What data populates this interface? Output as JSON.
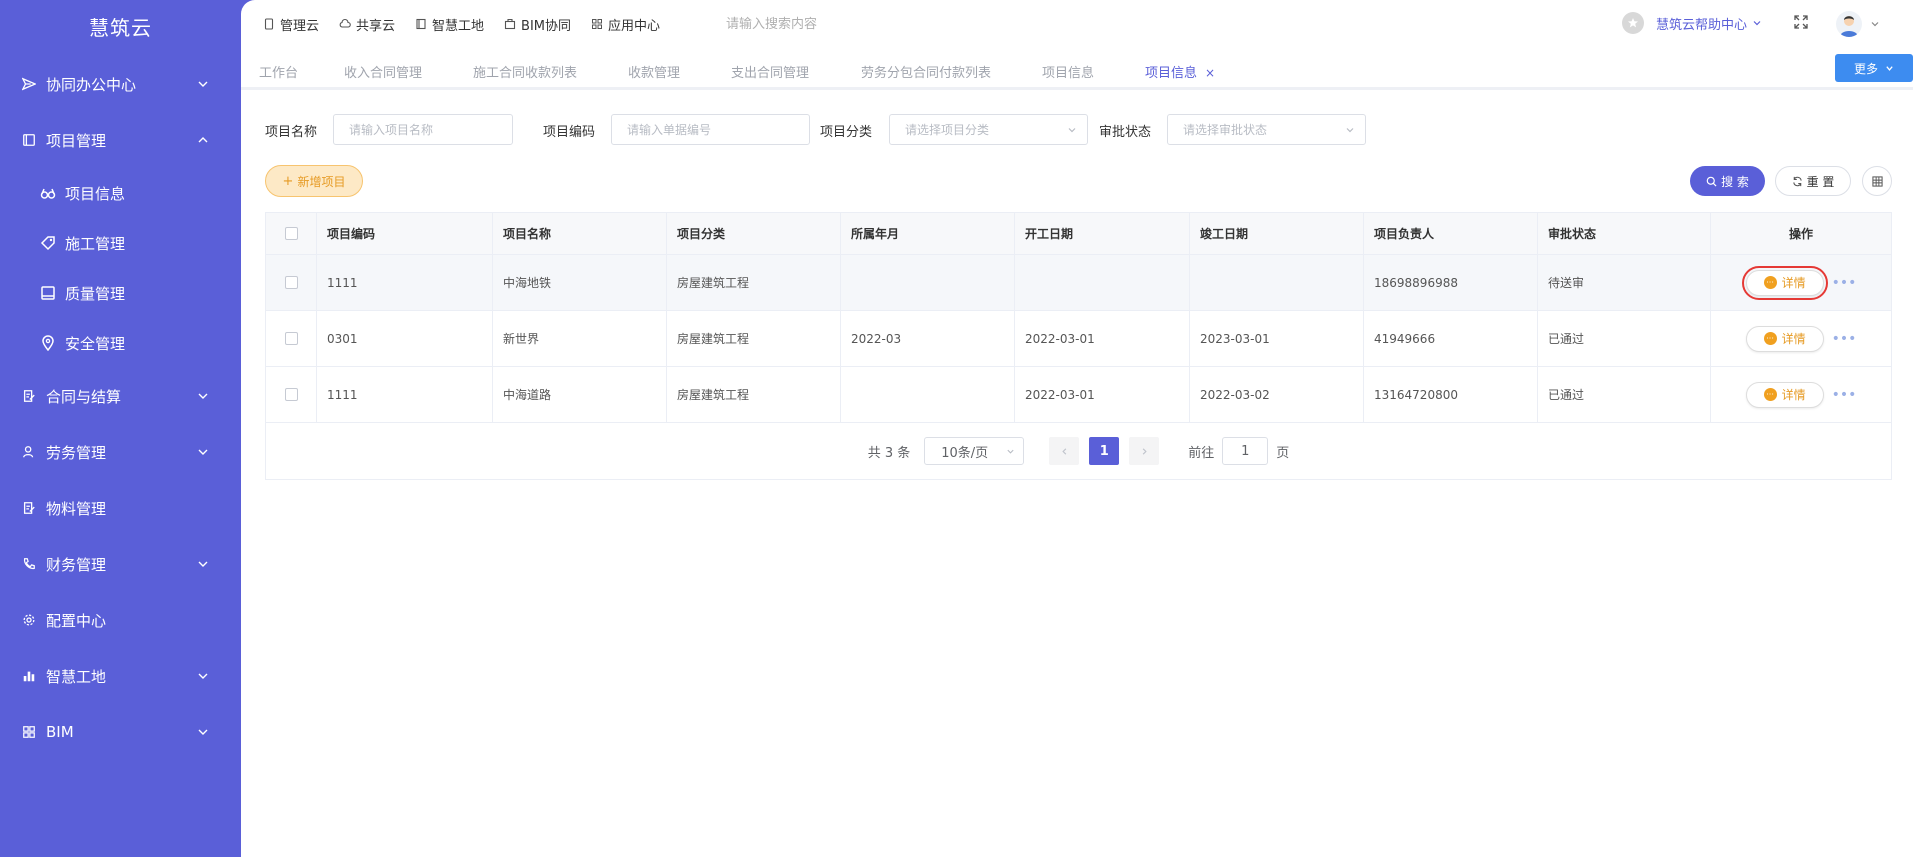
{
  "sidebar": {
    "brand": "慧筑云",
    "items": [
      {
        "label": "协同办公中心"
      },
      {
        "label": "项目管理"
      },
      {
        "label": "项目信息"
      },
      {
        "label": "施工管理"
      },
      {
        "label": "质量管理"
      },
      {
        "label": "安全管理"
      },
      {
        "label": "合同与结算"
      },
      {
        "label": "劳务管理"
      },
      {
        "label": "物料管理"
      },
      {
        "label": "财务管理"
      },
      {
        "label": "配置中心"
      },
      {
        "label": "智慧工地"
      },
      {
        "label": "BIM"
      }
    ]
  },
  "topnav": {
    "items": [
      {
        "label": "管理云",
        "icon": "phone-icon"
      },
      {
        "label": "共享云",
        "icon": "cloud-icon"
      },
      {
        "label": "智慧工地",
        "icon": "book-icon"
      },
      {
        "label": "BIM协同",
        "icon": "box-icon"
      },
      {
        "label": "应用中心",
        "icon": "grid-icon"
      }
    ],
    "search_placeholder": "请输入搜索内容",
    "help_label": "慧筑云帮助中心"
  },
  "tabs": {
    "items": [
      {
        "label": "工作台"
      },
      {
        "label": "收入合同管理"
      },
      {
        "label": "施工合同收款列表"
      },
      {
        "label": "收款管理"
      },
      {
        "label": "支出合同管理"
      },
      {
        "label": "劳务分包合同付款列表"
      },
      {
        "label": "项目信息"
      },
      {
        "label": "项目信息",
        "active": true
      }
    ],
    "close": "×",
    "more_label": "更多"
  },
  "filters": {
    "name_label": "项目名称",
    "name_placeholder": "请输入项目名称",
    "code_label": "项目编码",
    "code_placeholder": "请输入单据编号",
    "category_label": "项目分类",
    "category_placeholder": "请选择项目分类",
    "status_label": "审批状态",
    "status_placeholder": "请选择审批状态"
  },
  "toolbar": {
    "add_label": "新增项目",
    "search_label": "搜 索",
    "reset_label": "重 置"
  },
  "table": {
    "headers": [
      "项目编码",
      "项目名称",
      "项目分类",
      "所属年月",
      "开工日期",
      "竣工日期",
      "项目负责人",
      "审批状态",
      "操作"
    ],
    "rows": [
      [
        "1111",
        "中海地铁",
        "房屋建筑工程",
        "",
        "",
        "",
        "18698896988",
        "待送审"
      ],
      [
        "0301",
        "新世界",
        "房屋建筑工程",
        "2022-03",
        "2022-03-01",
        "2023-03-01",
        "41949666",
        "已通过"
      ],
      [
        "1111",
        "中海道路",
        "房屋建筑工程",
        "",
        "2022-03-01",
        "2022-03-02",
        "13164720800",
        "已通过"
      ]
    ],
    "detail_label": "详情",
    "more_dots": "•••"
  },
  "pagination": {
    "total": "共 3 条",
    "page_size": "10条/页",
    "current": "1",
    "goto_prefix": "前往",
    "goto_value": "1",
    "goto_suffix": "页"
  },
  "colors": {
    "sidebar": "#5a5fd8",
    "accent": "#5a5fd8",
    "more_button": "#3d8cf0",
    "warning": "#e69a23",
    "highlight": "#e53935"
  }
}
